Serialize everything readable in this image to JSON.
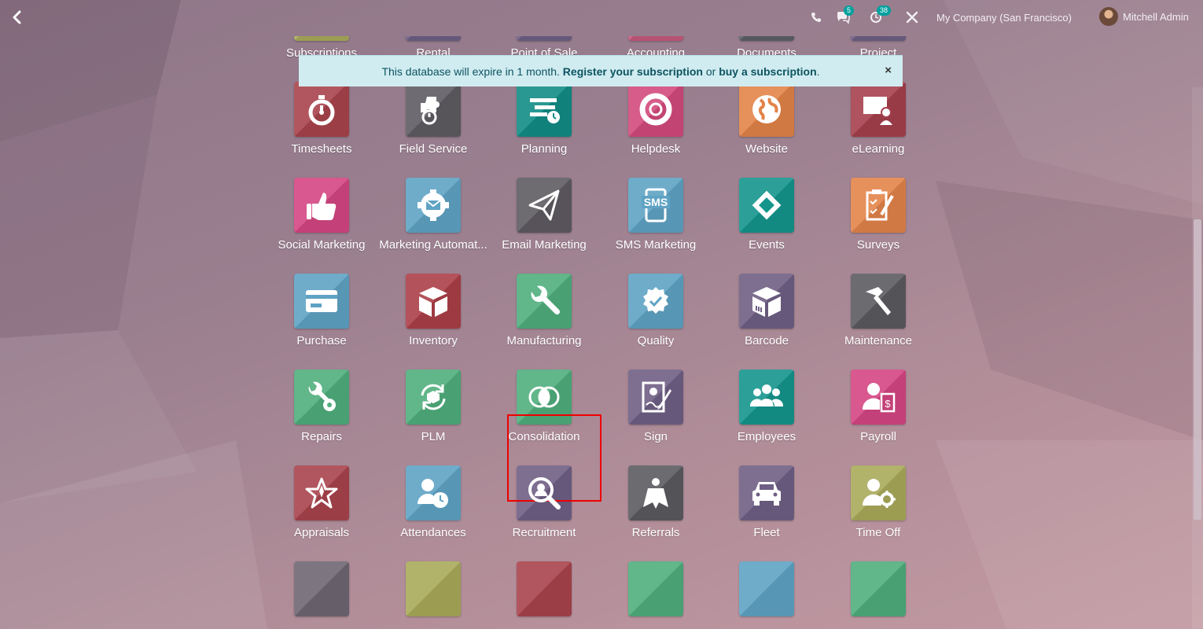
{
  "topbar": {
    "back_icon": "chevron-left-icon",
    "phone_icon": "phone-icon",
    "messages_count": "5",
    "activities_count": "38",
    "debug_icon": "tools-icon",
    "company": "My Company (San Francisco)",
    "user_name": "Mitchell Admin"
  },
  "banner": {
    "text_before": "This database will expire in 1 month.",
    "register_link": "Register your subscription",
    "middle": "or",
    "buy_link": "buy a subscription",
    "end": ".",
    "close": "×"
  },
  "apps": [
    {
      "label": "Subscriptions",
      "color": "#a9aa5a",
      "icon": "subscriptions-icon"
    },
    {
      "label": "Rental",
      "color": "#6f5f84",
      "icon": "rental-icon"
    },
    {
      "label": "Point of Sale",
      "color": "#6f5f84",
      "icon": "point-of-sale-icon"
    },
    {
      "label": "Accounting",
      "color": "#c45a7e",
      "icon": "accounting-icon"
    },
    {
      "label": "Documents",
      "color": "#5c5f66",
      "icon": "documents-icon"
    },
    {
      "label": "Project",
      "color": "#6f5f84",
      "icon": "project-icon"
    },
    {
      "label": "Timesheets",
      "color": "#a8434c",
      "icon": "stopwatch-icon"
    },
    {
      "label": "Field Service",
      "color": "#5e5b62",
      "icon": "field-service-icon"
    },
    {
      "label": "Planning",
      "color": "#128c86",
      "icon": "planning-icon"
    },
    {
      "label": "Helpdesk",
      "color": "#d24a7c",
      "icon": "lifebuoy-icon"
    },
    {
      "label": "Website",
      "color": "#e38348",
      "icon": "globe-icon"
    },
    {
      "label": "eLearning",
      "color": "#a5404d",
      "icon": "elearning-icon"
    },
    {
      "label": "Social Marketing",
      "color": "#d44582",
      "icon": "thumbs-up-icon"
    },
    {
      "label": "Marketing Automat...",
      "color": "#5fa3c4",
      "icon": "gear-mail-icon"
    },
    {
      "label": "Email Marketing",
      "color": "#5e5a61",
      "icon": "paper-plane-icon"
    },
    {
      "label": "SMS Marketing",
      "color": "#5fa3c4",
      "icon": "sms-icon"
    },
    {
      "label": "Events",
      "color": "#14958c",
      "icon": "ticket-icon"
    },
    {
      "label": "Surveys",
      "color": "#e3834a",
      "icon": "checklist-icon"
    },
    {
      "label": "Purchase",
      "color": "#5fa3c4",
      "icon": "credit-card-icon"
    },
    {
      "label": "Inventory",
      "color": "#ab3f48",
      "icon": "box-icon"
    },
    {
      "label": "Manufacturing",
      "color": "#4fae7d",
      "icon": "wrench-icon"
    },
    {
      "label": "Quality",
      "color": "#5fa3c4",
      "icon": "quality-seal-icon"
    },
    {
      "label": "Barcode",
      "color": "#6f5f84",
      "icon": "barcode-box-icon"
    },
    {
      "label": "Maintenance",
      "color": "#5b5a60",
      "icon": "hammer-icon"
    },
    {
      "label": "Repairs",
      "color": "#4fae7d",
      "icon": "repair-tools-icon"
    },
    {
      "label": "PLM",
      "color": "#4fae7d",
      "icon": "plm-cycle-icon"
    },
    {
      "label": "Consolidation",
      "color": "#4fae7d",
      "icon": "overlapping-circles-icon"
    },
    {
      "label": "Sign",
      "color": "#6f5f84",
      "icon": "sign-document-icon"
    },
    {
      "label": "Employees",
      "color": "#14958c",
      "icon": "people-icon"
    },
    {
      "label": "Payroll",
      "color": "#d44582",
      "icon": "payroll-icon"
    },
    {
      "label": "Appraisals",
      "color": "#a8434c",
      "icon": "star-icon"
    },
    {
      "label": "Attendances",
      "color": "#5fa3c4",
      "icon": "attendance-clock-icon"
    },
    {
      "label": "Recruitment",
      "color": "#6f5f84",
      "icon": "magnifier-person-icon"
    },
    {
      "label": "Referrals",
      "color": "#5b5a60",
      "icon": "superhero-icon"
    },
    {
      "label": "Fleet",
      "color": "#6f5f84",
      "icon": "car-icon"
    },
    {
      "label": "Time Off",
      "color": "#a9aa5a",
      "icon": "person-gear-icon"
    },
    {
      "label": "",
      "color": "#6e6772",
      "icon": "app-icon"
    },
    {
      "label": "",
      "color": "#a9aa5a",
      "icon": "app-icon"
    },
    {
      "label": "",
      "color": "#a8434c",
      "icon": "app-icon"
    },
    {
      "label": "",
      "color": "#4fae7d",
      "icon": "app-icon"
    },
    {
      "label": "",
      "color": "#5fa3c4",
      "icon": "app-icon"
    },
    {
      "label": "",
      "color": "#4fae7d",
      "icon": "app-icon"
    }
  ],
  "highlight_app": "Consolidation"
}
